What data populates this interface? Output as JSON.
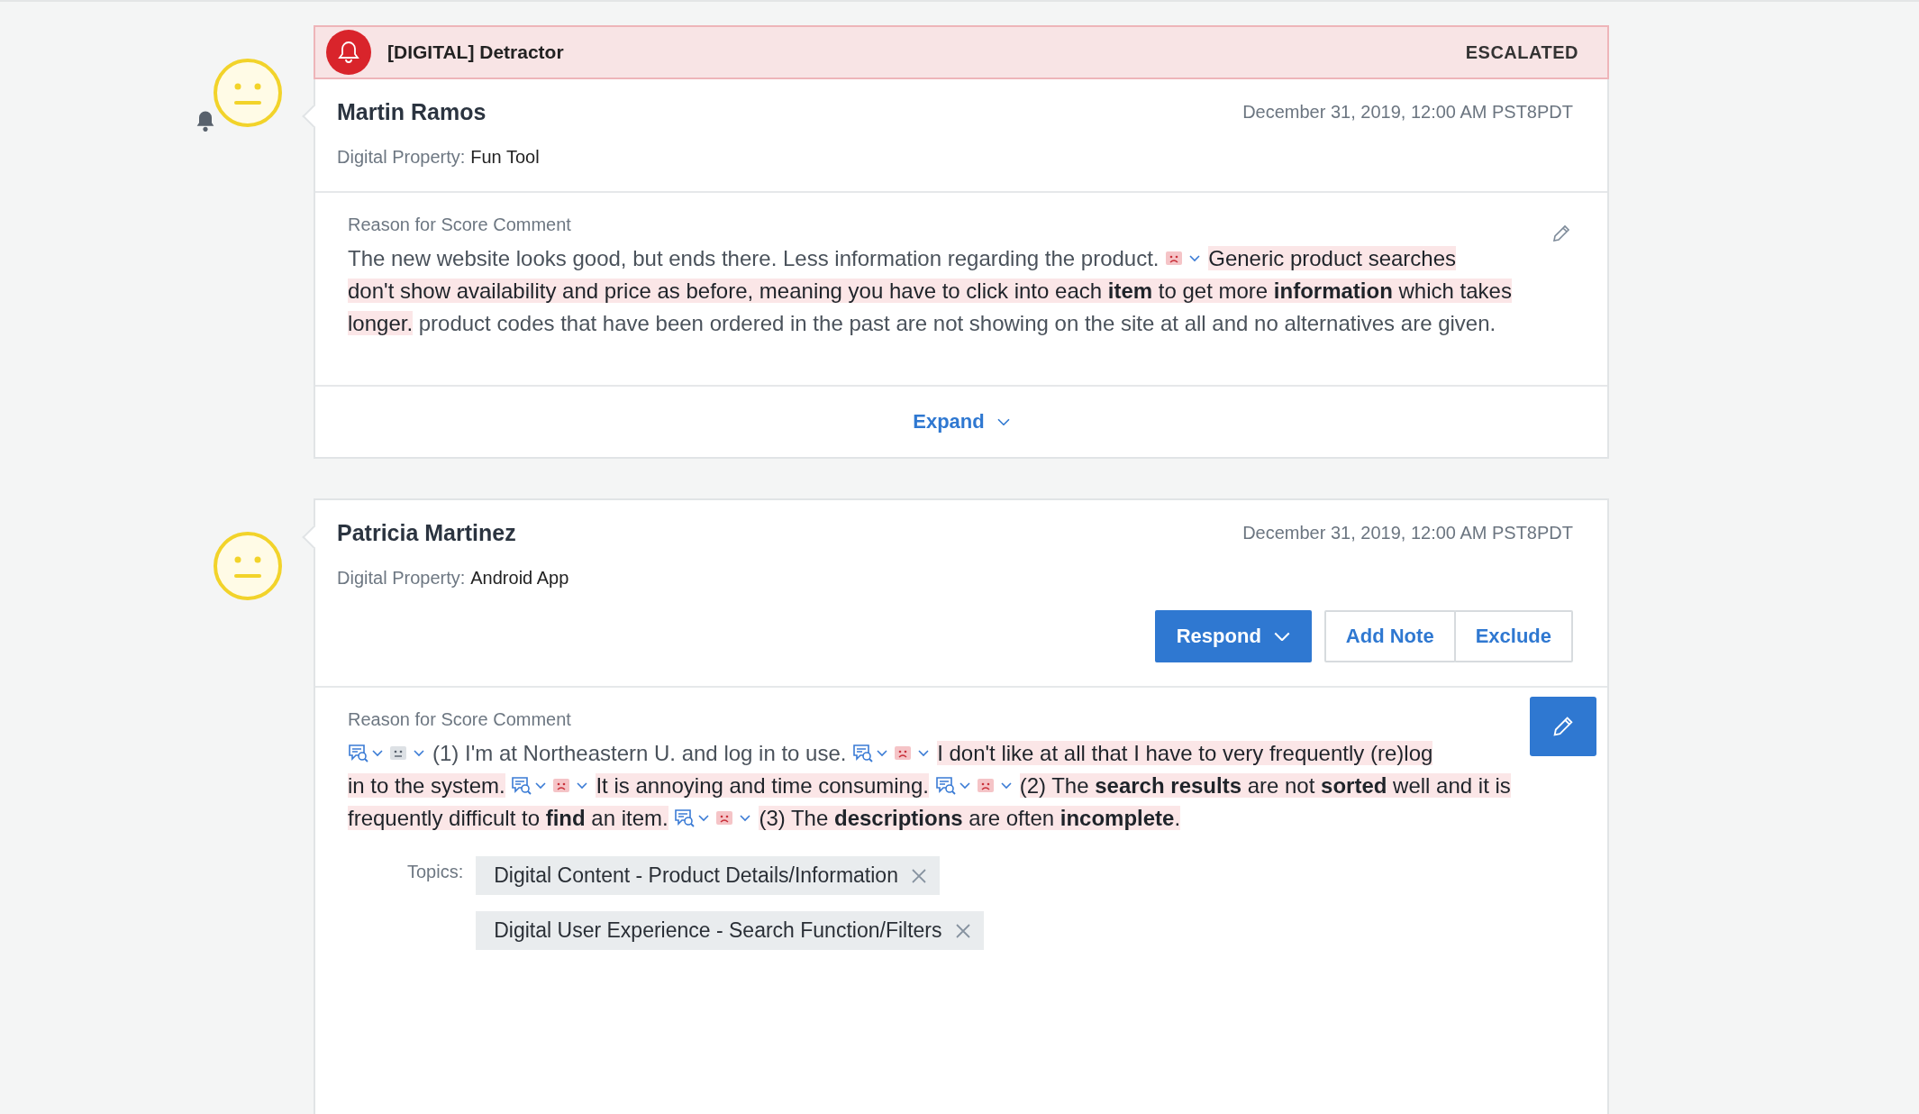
{
  "cards": [
    {
      "alert": {
        "label": "[DIGITAL] Detractor",
        "status": "ESCALATED"
      },
      "notified": true,
      "name": "Martin Ramos",
      "date": "December 31, 2019, 12:00 AM PST8PDT",
      "property": {
        "label": "Digital Property:",
        "value": "Fun Tool"
      },
      "comment_label": "Reason for Score Comment",
      "edit_active": false,
      "lines": [
        [
          {
            "highlighted": false,
            "topic_tag": false,
            "kind": "plain",
            "text": "The new website looks good, but ends there. Less information regarding the product."
          },
          {
            "highlighted": true,
            "topic_tag": false,
            "kind": "negative",
            "text": "Generic product searches"
          }
        ],
        [
          {
            "highlighted": true,
            "topic_tag": false,
            "kind": "plain",
            "text": "don't show availability and price as before, meaning you have to click into each **item** to get more **information** which takes"
          }
        ],
        [
          {
            "highlighted": true,
            "topic_tag": false,
            "kind": "plain",
            "text": "longer."
          },
          {
            "highlighted": false,
            "topic_tag": false,
            "kind": "plain",
            "text": "product codes that have been ordered in the past are not showing on the site at all and no alternatives are given."
          }
        ]
      ],
      "expand": "Expand"
    },
    {
      "notified": false,
      "name": "Patricia Martinez",
      "date": "December 31, 2019, 12:00 AM PST8PDT",
      "property": {
        "label": "Digital Property:",
        "value": "Android App"
      },
      "actions": [
        {
          "label": "Respond",
          "kind": "menu"
        },
        {
          "label": "Add Note",
          "kind": "outline"
        },
        {
          "label": "Exclude",
          "kind": "outline"
        }
      ],
      "comment_label": "Reason for Score Comment",
      "edit_active": true,
      "lines": [
        [
          {
            "highlighted": false,
            "topic_tag": true,
            "kind": "neutral",
            "text": "(1) I'm at Northeastern U. and log in to use."
          },
          {
            "highlighted": true,
            "topic_tag": true,
            "kind": "negative",
            "text": "I don't like at all that I have to very frequently (re)log"
          }
        ],
        [
          {
            "highlighted": true,
            "topic_tag": false,
            "kind": "plain",
            "text": "in to the system."
          },
          {
            "highlighted": true,
            "topic_tag": true,
            "kind": "negative",
            "text": "It is annoying and time consuming."
          },
          {
            "highlighted": true,
            "topic_tag": true,
            "kind": "negative",
            "text": "(2) The **search results** are not **sorted** well and it is"
          }
        ],
        [
          {
            "highlighted": true,
            "topic_tag": false,
            "kind": "plain",
            "text": "frequently difficult to **find** an item."
          },
          {
            "highlighted": true,
            "topic_tag": true,
            "kind": "negative",
            "text": "(3) The **descriptions** are often **incomplete**."
          }
        ]
      ],
      "topics_label": "Topics:",
      "topics": [
        "Digital Content - Product Details/Information",
        "Digital User Experience - Search Function/Filters"
      ]
    }
  ]
}
